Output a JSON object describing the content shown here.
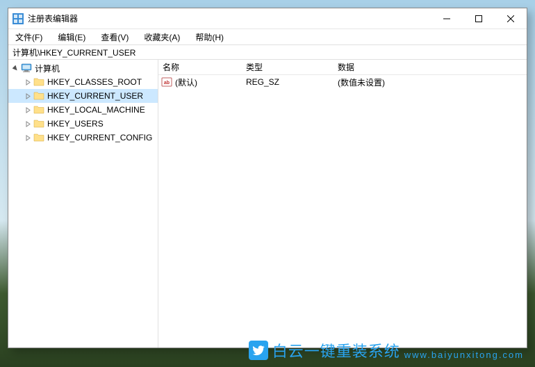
{
  "window": {
    "title": "注册表编辑器"
  },
  "menu": {
    "file": "文件(F)",
    "edit": "编辑(E)",
    "view": "查看(V)",
    "favorites": "收藏夹(A)",
    "help": "帮助(H)"
  },
  "address": "计算机\\HKEY_CURRENT_USER",
  "tree": {
    "root": "计算机",
    "items": [
      "HKEY_CLASSES_ROOT",
      "HKEY_CURRENT_USER",
      "HKEY_LOCAL_MACHINE",
      "HKEY_USERS",
      "HKEY_CURRENT_CONFIG"
    ],
    "selected_index": 1
  },
  "list": {
    "headers": {
      "name": "名称",
      "type": "类型",
      "data": "数据"
    },
    "rows": [
      {
        "name": "(默认)",
        "type": "REG_SZ",
        "data": "(数值未设置)"
      }
    ]
  },
  "watermark": {
    "cn": "白云一键重装系统",
    "url": "www.baiyunxitong.com"
  }
}
